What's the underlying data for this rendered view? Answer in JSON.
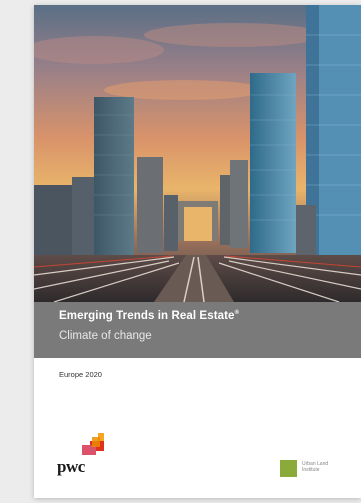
{
  "report": {
    "title": "Emerging Trends in Real Estate",
    "title_mark": "®",
    "subtitle": "Climate of change",
    "edition": "Europe 2020"
  },
  "logos": {
    "pwc": "pwc",
    "uli_line1": "Urban Land",
    "uli_line2": "Institute"
  },
  "colors": {
    "band": "#7a7a7a",
    "pwc_orange": "#e0301e",
    "uli_green": "#8aaa3a"
  }
}
